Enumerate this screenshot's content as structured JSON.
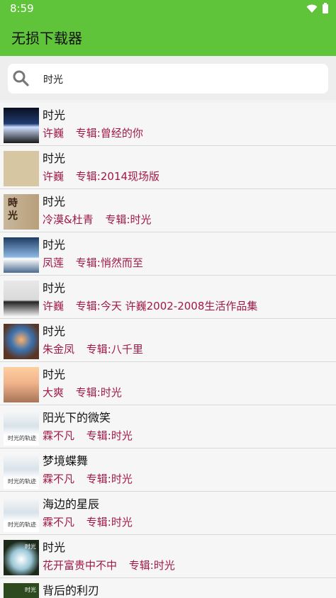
{
  "status_bar": {
    "time": "8:59",
    "icons": [
      "wifi-icon",
      "battery-icon"
    ]
  },
  "app_bar": {
    "title": "无损下载器"
  },
  "search": {
    "query": "时光",
    "icon": "search-icon"
  },
  "songs": [
    {
      "title": "时光",
      "artist": "许巍",
      "album": "专辑:曾经的你"
    },
    {
      "title": "时光",
      "artist": "许巍",
      "album": "专辑:2014现场版"
    },
    {
      "title": "时光",
      "artist": "冷漠&杜青",
      "album": "专辑:时光"
    },
    {
      "title": "时光",
      "artist": "凤莲",
      "album": "专辑:悄然而至"
    },
    {
      "title": "时光",
      "artist": "许巍",
      "album": "专辑:今天 许巍2002-2008生活作品集"
    },
    {
      "title": "时光",
      "artist": "朱金凤",
      "album": "专辑:八千里"
    },
    {
      "title": "时光",
      "artist": "大爽",
      "album": "专辑:时光"
    },
    {
      "title": "阳光下的微笑",
      "artist": "霖不凡",
      "album": "专辑:时光"
    },
    {
      "title": "梦境蝶舞",
      "artist": "霖不凡",
      "album": "专辑:时光"
    },
    {
      "title": "海边的星辰",
      "artist": "霖不凡",
      "album": "专辑:时光"
    },
    {
      "title": "时光",
      "artist": "花开富贵中不中",
      "album": "专辑:时光"
    },
    {
      "title": "背后的利刃",
      "artist": "",
      "album": ""
    }
  ],
  "thumbnail_text": {
    "t2_line1": "時",
    "t2_line2": "光",
    "t7": "时光的轨迹",
    "t8": "时光的轨迹",
    "t9": "时光的轨迹",
    "t10": "时光",
    "t11": "时光"
  },
  "colors": {
    "accent": "#5fc43a",
    "sub_text": "#a11946"
  }
}
